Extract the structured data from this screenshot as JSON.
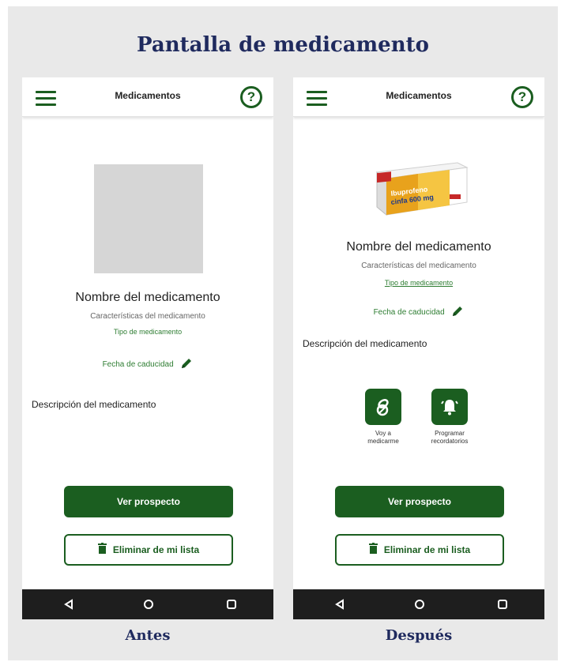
{
  "title": "Pantalla de medicamento",
  "before": {
    "caption": "Antes",
    "appbar_title": "Medicamentos",
    "med_name": "Nombre del medicamento",
    "med_characteristics": "Características del medicamento",
    "med_type": "Tipo de medicamento",
    "expiry": "Fecha de caducidad",
    "description": "Descripción del medicamento",
    "view_leaflet": "Ver prospecto",
    "remove": "Eliminar de mi lista"
  },
  "after": {
    "caption": "Después",
    "appbar_title": "Medicamentos",
    "med_name": "Nombre del medicamento",
    "med_characteristics": "Características del medicamento",
    "med_type": "Tipo de medicamento",
    "expiry": "Fecha de caducidad",
    "description": "Descripción del medicamento",
    "feature_take": "Voy a medicarme",
    "feature_remind": "Programar recordatorios",
    "view_leaflet": "Ver prospecto",
    "remove": "Eliminar de mi lista",
    "box_brand_line1": "Ibuprofeno",
    "box_brand_line2": "cinfa 600 mg"
  },
  "colors": {
    "accent": "#1b5e20",
    "title": "#1f2a5e",
    "background": "#e9e9e9",
    "navbar": "#1e1e1e"
  },
  "icons": [
    "menu-icon",
    "help-icon",
    "pencil-icon",
    "trash-icon",
    "pills-icon",
    "bell-icon",
    "back-icon",
    "home-icon",
    "recents-icon"
  ]
}
